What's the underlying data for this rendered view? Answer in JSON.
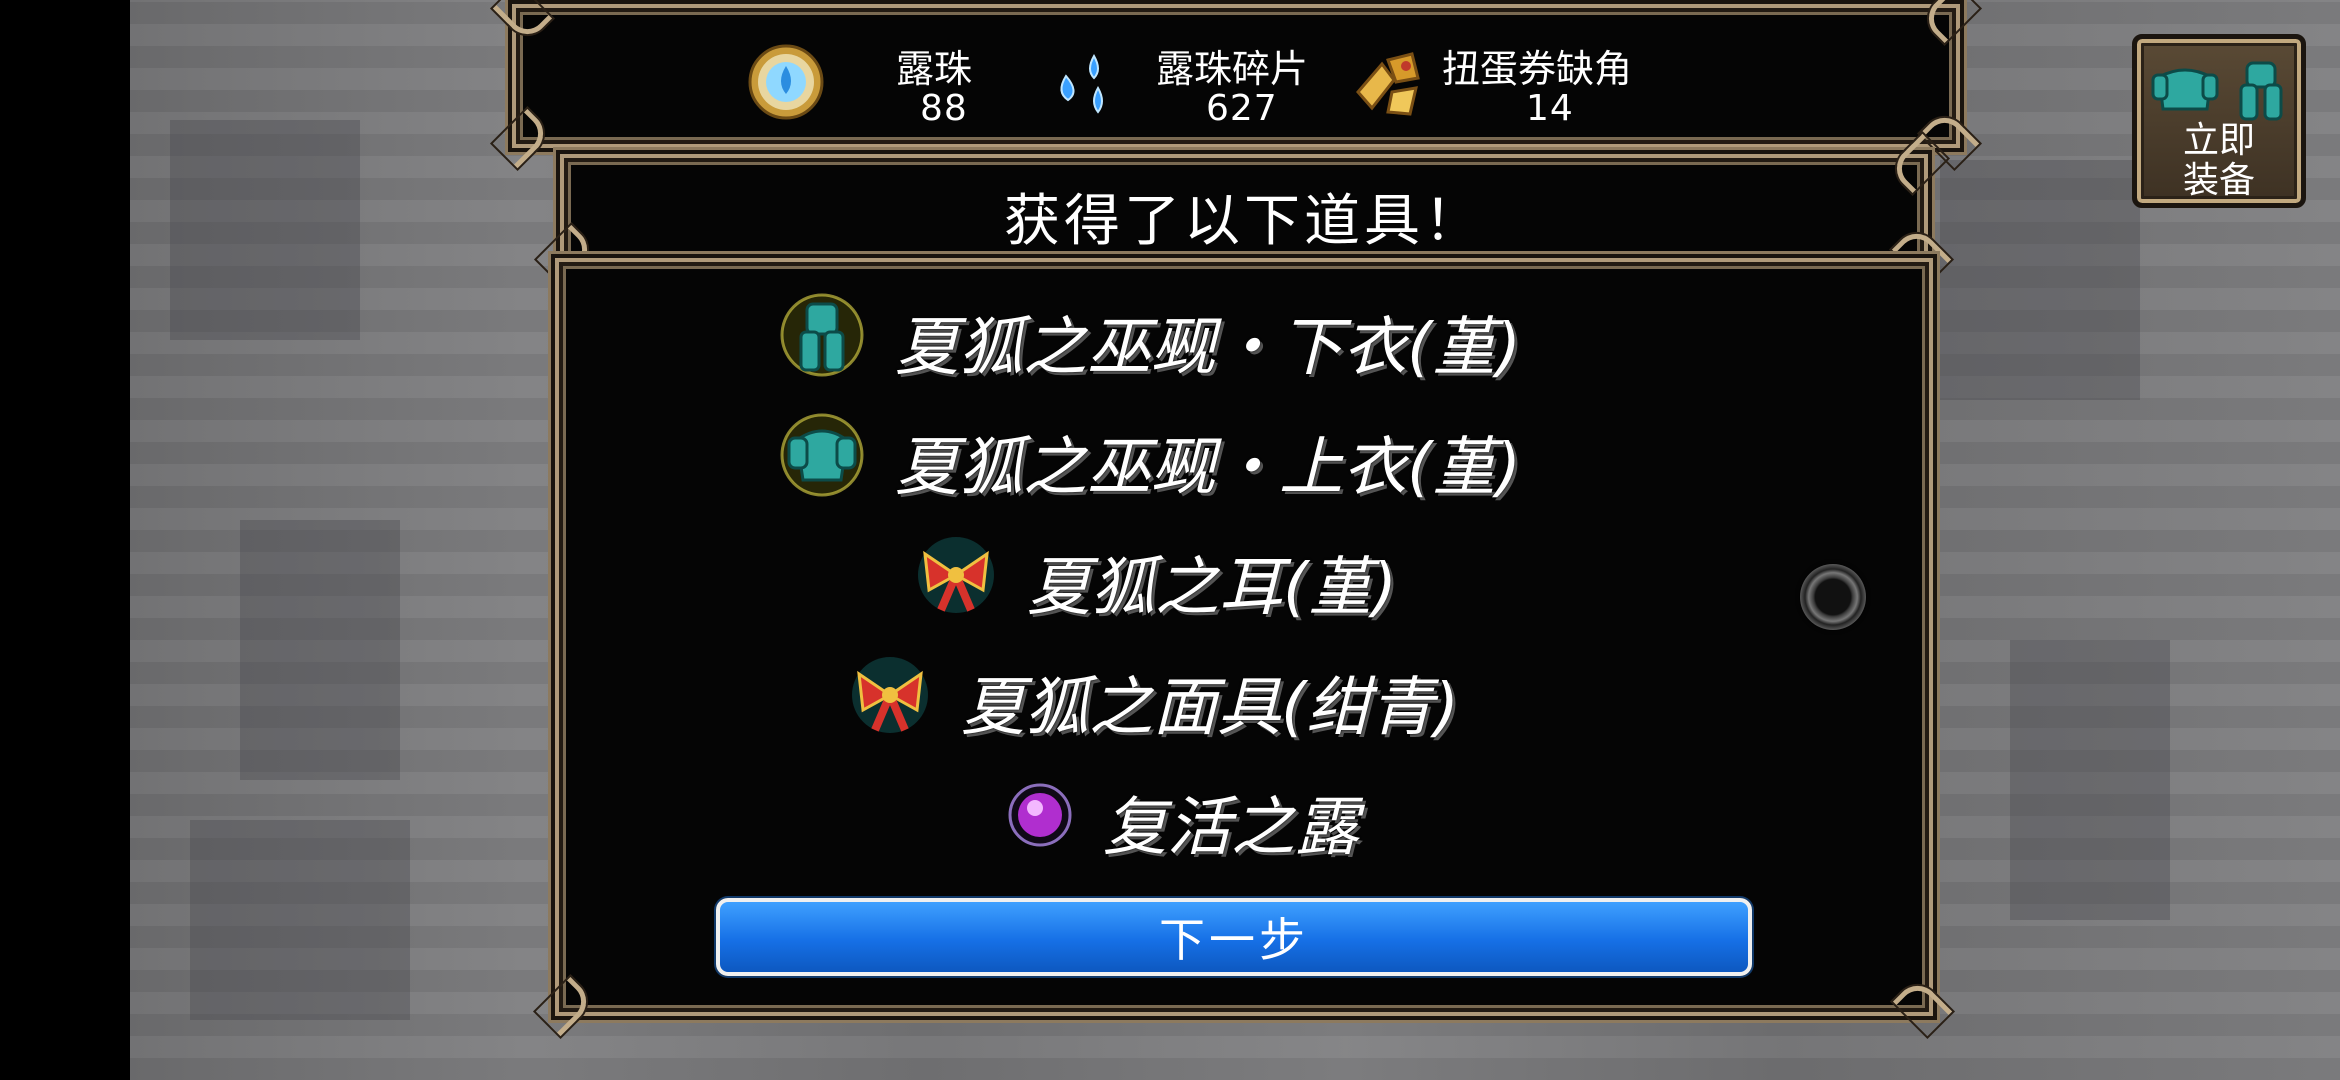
{
  "currency_bar": {
    "items": [
      {
        "name": "露珠",
        "value": "88",
        "icon": "dewdrop-orb-icon"
      },
      {
        "name": "露珠碎片",
        "value": "627",
        "icon": "dew-fragment-icon"
      },
      {
        "name": "扭蛋券缺角",
        "value": "14",
        "icon": "gacha-ticket-fragment-icon"
      }
    ]
  },
  "dialog": {
    "title": "获得了以下道具！",
    "items": [
      {
        "name": "夏狐之巫觋・下衣(堇)",
        "icon": "armor-lower-icon"
      },
      {
        "name": "夏狐之巫觋・上衣(堇)",
        "icon": "armor-upper-icon"
      },
      {
        "name": "夏狐之耳(堇)",
        "icon": "ribbon-bow-icon"
      },
      {
        "name": "夏狐之面具(绀青)",
        "icon": "ribbon-bow-icon"
      },
      {
        "name": "复活之露",
        "icon": "purple-orb-icon"
      }
    ],
    "next_label": "下一步"
  },
  "equip_now": {
    "label": "立即\n装备",
    "icon": "armor-set-icon"
  },
  "colors": {
    "frame_gold": "#b09a7a",
    "button_blue": "#1670e6",
    "teal_armor": "#2ea8a0",
    "background_gray": "#7b7b7d"
  }
}
